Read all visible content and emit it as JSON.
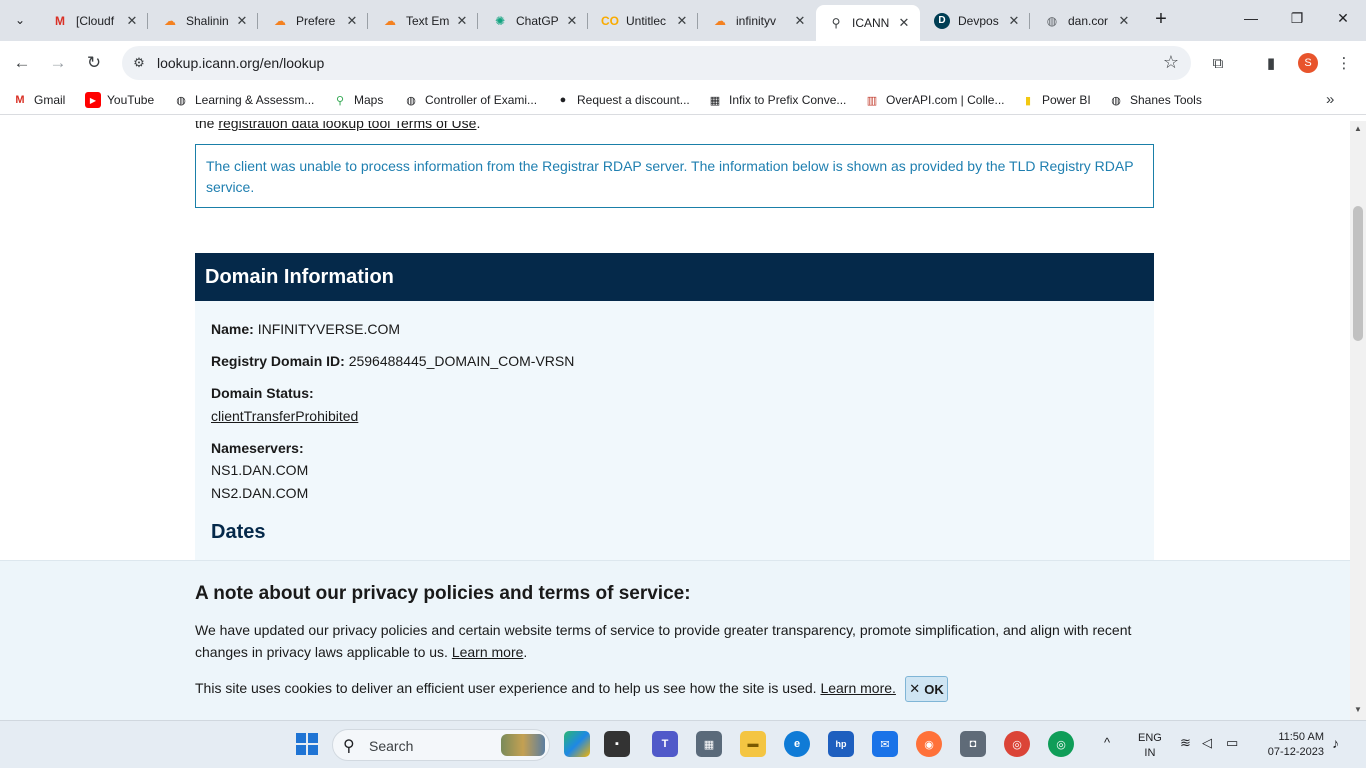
{
  "browser": {
    "tabs": [
      {
        "label": "[Cloudf",
        "icon": "gmail-icon",
        "color": "#d93025"
      },
      {
        "label": "Shalinin",
        "icon": "cloudflare-icon",
        "color": "#f48120"
      },
      {
        "label": "Prefere",
        "icon": "cloudflare-icon",
        "color": "#f48120"
      },
      {
        "label": "Text Em",
        "icon": "cloudflare-icon",
        "color": "#f48120"
      },
      {
        "label": "ChatGP",
        "icon": "chatgpt-icon",
        "color": "#10a37f"
      },
      {
        "label": "Untitlec",
        "icon": "colab-icon",
        "color": "#f9ab00"
      },
      {
        "label": "infinityv",
        "icon": "cloudflare-icon",
        "color": "#f48120"
      },
      {
        "label": "ICANN",
        "icon": "icann-icon",
        "color": "#3c4043"
      },
      {
        "label": "Devpos",
        "icon": "devpost-icon",
        "color": "#003e54"
      },
      {
        "label": "dan.cor",
        "icon": "globe-icon",
        "color": "#5f6368"
      }
    ],
    "url": "lookup.icann.org/en/lookup",
    "profile_initial": "S",
    "bookmarks": [
      {
        "label": "Gmail"
      },
      {
        "label": "YouTube"
      },
      {
        "label": "Learning & Assessm..."
      },
      {
        "label": "Maps"
      },
      {
        "label": "Controller of Exami..."
      },
      {
        "label": "Request a discount..."
      },
      {
        "label": "Infix to Prefix Conve..."
      },
      {
        "label": "OverAPI.com | Colle..."
      },
      {
        "label": "Power BI"
      },
      {
        "label": "Shanes Tools"
      }
    ]
  },
  "page": {
    "terms_prefix": "the ",
    "terms_link": "registration data lookup tool Terms of Use",
    "terms_suffix": ".",
    "notice": "The client was unable to process information from the Registrar RDAP server. The information below is shown as provided by the TLD Registry RDAP service.",
    "domain_info": {
      "heading": "Domain Information",
      "name_label": "Name:",
      "name_value": "INFINITYVERSE.COM",
      "registry_id_label": "Registry Domain ID:",
      "registry_id_value": "2596488445_DOMAIN_COM-VRSN",
      "status_label": "Domain Status:",
      "status_value": "clientTransferProhibited",
      "nameservers_label": "Nameservers:",
      "nameservers": [
        "NS1.DAN.COM",
        "NS2.DAN.COM"
      ],
      "dates_heading": "Dates"
    },
    "privacy_banner": {
      "title": "A note about our privacy policies and terms of service:",
      "text1": "We have updated our privacy policies and certain website terms of service to provide greater transparency, promote simplification, and align with recent changes in privacy laws applicable to us. ",
      "link1": "Learn more",
      "text1_suffix": ".",
      "text2": "This site uses cookies to deliver an efficient user experience and to help us see how the site is used. ",
      "link2": "Learn more.",
      "ok_label": "OK"
    }
  },
  "taskbar": {
    "search_placeholder": "Search",
    "lang_line1": "ENG",
    "lang_line2": "IN",
    "time": "11:50 AM",
    "date": "07-12-2023"
  }
}
